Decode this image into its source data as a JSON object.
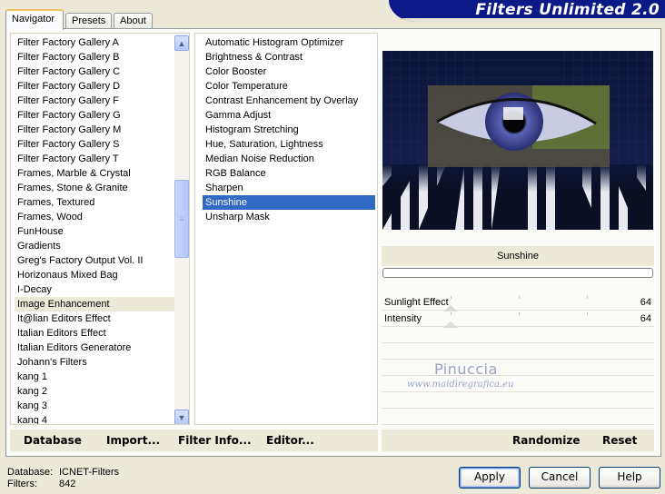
{
  "tabs": [
    "Navigator",
    "Presets",
    "About"
  ],
  "header": {
    "title": "Filters Unlimited 2.0"
  },
  "categories": [
    "Filter Factory Gallery A",
    "Filter Factory Gallery B",
    "Filter Factory Gallery C",
    "Filter Factory Gallery D",
    "Filter Factory Gallery F",
    "Filter Factory Gallery G",
    "Filter Factory Gallery M",
    "Filter Factory Gallery S",
    "Filter Factory Gallery T",
    "Frames, Marble & Crystal",
    "Frames, Stone & Granite",
    "Frames, Textured",
    "Frames, Wood",
    "FunHouse",
    "Gradients",
    "Greg's Factory Output Vol. II",
    "Horizonaus Mixed Bag",
    "I-Decay",
    "Image Enhancement",
    "It@lian Editors Effect",
    "Italian Editors Effect",
    "Italian Editors Generatore",
    "Johann's Filters",
    "kang 1",
    "kang 2",
    "kang 3",
    "kang 4"
  ],
  "categories_selected": "Image Enhancement",
  "filters": [
    "Automatic Histogram Optimizer",
    "Brightness & Contrast",
    "Color Booster",
    "Color Temperature",
    "Contrast Enhancement by Overlay",
    "Gamma Adjust",
    "Histogram Stretching",
    "Hue, Saturation, Lightness",
    "Median Noise Reduction",
    "RGB Balance",
    "Sharpen",
    "Sunshine",
    "Unsharp Mask"
  ],
  "filters_selected": "Sunshine",
  "current_filter": "Sunshine",
  "sliders": [
    {
      "label": "Sunlight Effect",
      "value": "64"
    },
    {
      "label": "Intensity",
      "value": "64"
    }
  ],
  "watermark": {
    "name": "Pinuccia",
    "url": "www.maidiregrafica.eu"
  },
  "toolbar": {
    "database": "Database",
    "import": "Import...",
    "filter_info": "Filter Info...",
    "editor": "Editor...",
    "randomize": "Randomize",
    "reset": "Reset"
  },
  "info": {
    "database_label": "Database:",
    "database_value": "ICNET-Filters",
    "filters_label": "Filters:",
    "filters_value": "842"
  },
  "buttons": {
    "apply": "Apply",
    "cancel": "Cancel",
    "help": "Help"
  },
  "colors": {
    "selection": "#316ac5",
    "banner": "#0b1a86",
    "dialog_bg": "#ece9d8"
  }
}
